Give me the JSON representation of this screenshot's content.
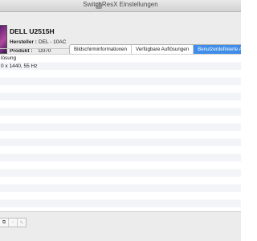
{
  "window": {
    "title": "SwitchResX Einstellungen"
  },
  "monitor": {
    "name": "DELL U2515H",
    "manufacturer_label": "Hersteller :",
    "manufacturer_value": "DEL - 10AC",
    "product_label": "Produkt :",
    "product_value": "D070"
  },
  "tabs": [
    {
      "label": "Bildschirminformationen",
      "active": false
    },
    {
      "label": "Verfügbare Auflösungen",
      "active": false
    },
    {
      "label": "Benutzerdefinierte Auflö",
      "active": true
    }
  ],
  "list": {
    "header": "lösung",
    "rows": [
      "0 x 1440, 55 Hz"
    ]
  },
  "toolbar": {
    "buttons": [
      {
        "icon": "copy-icon",
        "glyph": "⧉",
        "enabled": true
      },
      {
        "icon": "minus-icon",
        "glyph": "−",
        "enabled": false
      },
      {
        "icon": "edit-icon",
        "glyph": "✎",
        "enabled": false
      }
    ]
  },
  "colors": {
    "accent": "#3f8de8",
    "row_stripe": "#f2f4f7"
  }
}
